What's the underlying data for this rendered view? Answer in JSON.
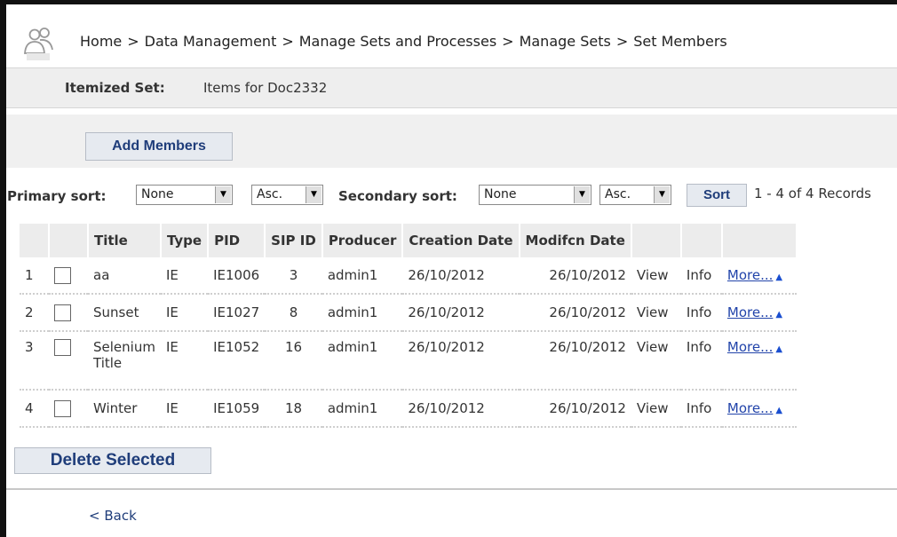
{
  "breadcrumb": {
    "items": [
      "Home",
      "Data Management",
      "Manage Sets and Processes",
      "Manage Sets",
      "Set Members"
    ],
    "separator": ">"
  },
  "set": {
    "label": "Itemized Set:",
    "value": "Items for Doc2332"
  },
  "toolbar": {
    "add_members": "Add Members"
  },
  "sorting": {
    "primary_label": "Primary sort:",
    "primary_value": "None",
    "primary_order": "Asc.",
    "secondary_label": "Secondary sort:",
    "secondary_value": "None",
    "secondary_order": "Asc.",
    "sort_button": "Sort",
    "records": "1 - 4 of 4 Records"
  },
  "table": {
    "headers": [
      "Title",
      "Type",
      "PID",
      "SIP ID",
      "Producer",
      "Creation Date",
      "Modifcn Date"
    ],
    "rows": [
      {
        "num": "1",
        "title": "aa",
        "title2": "",
        "type": "IE",
        "pid": "IE1006",
        "sip": "3",
        "producer": "admin1",
        "created": "26/10/2012",
        "modified": "26/10/2012",
        "view": "View",
        "info": "Info",
        "more": "More..."
      },
      {
        "num": "2",
        "title": "Sunset",
        "title2": "",
        "type": "IE",
        "pid": "IE1027",
        "sip": "8",
        "producer": "admin1",
        "created": "26/10/2012",
        "modified": "26/10/2012",
        "view": "View",
        "info": "Info",
        "more": "More..."
      },
      {
        "num": "3",
        "title": "Selenium",
        "title2": "Title",
        "type": "IE",
        "pid": "IE1052",
        "sip": "16",
        "producer": "admin1",
        "created": "26/10/2012",
        "modified": "26/10/2012",
        "view": "View",
        "info": "Info",
        "more": "More..."
      },
      {
        "num": "4",
        "title": "Winter",
        "title2": "",
        "type": "IE",
        "pid": "IE1059",
        "sip": "18",
        "producer": "admin1",
        "created": "26/10/2012",
        "modified": "26/10/2012",
        "view": "View",
        "info": "Info",
        "more": "More..."
      }
    ]
  },
  "actions": {
    "delete_selected": "Delete Selected",
    "back": "< Back"
  },
  "icons": {
    "logo": "users-icon",
    "dropdown": "dropdown-arrow-icon",
    "more": "triangle-up-icon"
  },
  "colors": {
    "button_text": "#1f3d7a",
    "link": "#2244aa",
    "bar_bg": "#eeeeee"
  }
}
